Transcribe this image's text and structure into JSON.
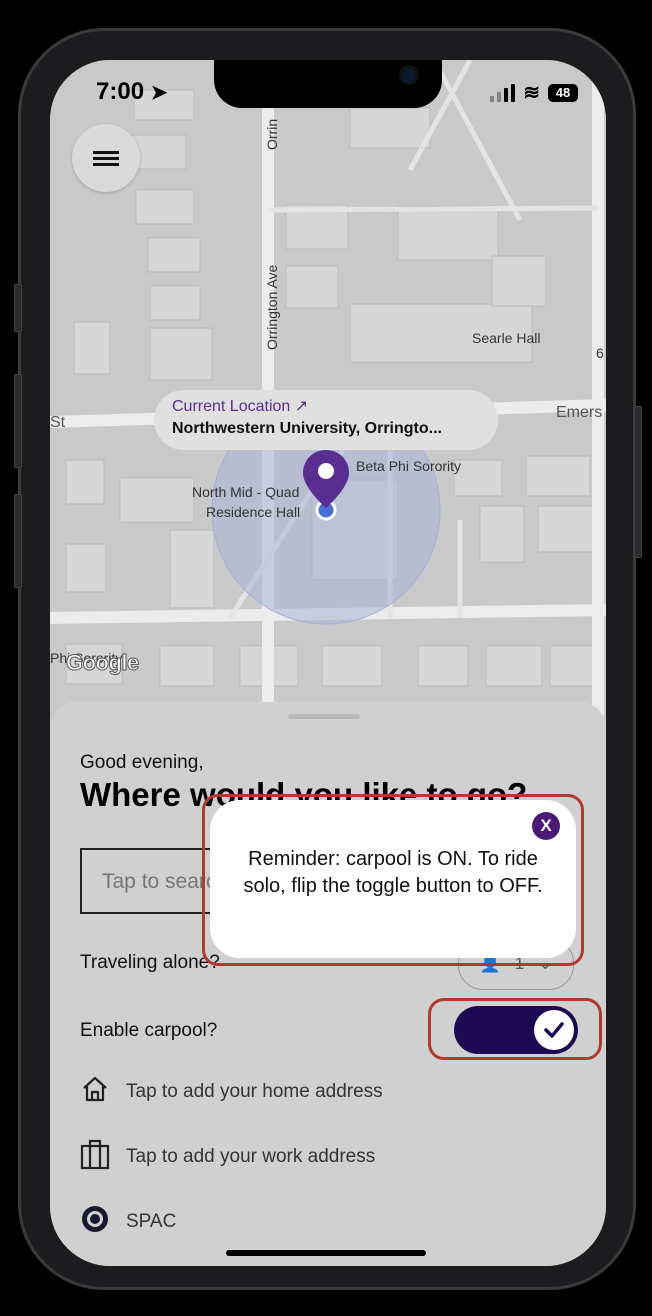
{
  "status": {
    "time": "7:00",
    "battery": "48"
  },
  "map": {
    "current_location_label": "Current Location",
    "current_location_address": "Northwestern University, Orringto...",
    "labels": {
      "orrington_ave": "Orrington Ave",
      "orrington_top": "Orrin",
      "searle_hall": "Searle Hall",
      "emerson": "Emers",
      "st": "St",
      "beta_phi": "Beta Phi Sorority",
      "north_mid_1": "North Mid - Quad",
      "north_mid_2": "Residence Hall",
      "phi_sorority": "Phi Sorority",
      "six": "6"
    },
    "attribution": "Google"
  },
  "sheet": {
    "greeting": "Good evening,",
    "headline": "Where would you like to go?",
    "search_placeholder": "Tap to search",
    "traveling_alone_label": "Traveling alone?",
    "passenger_count": "1",
    "carpool_label": "Enable carpool?",
    "carpool_enabled": true,
    "home_address_label": "Tap to add your home address",
    "work_address_label": "Tap to add your work address",
    "saved_place": "SPAC"
  },
  "popup": {
    "message": "Reminder: carpool is ON. To ride solo, flip the toggle button to OFF.",
    "close_label": "X"
  },
  "colors": {
    "accent_purple": "#5a2d91",
    "toggle_bg": "#1c0a54",
    "highlight_red": "#b03a2e",
    "location_blue": "#4a6cd4"
  }
}
